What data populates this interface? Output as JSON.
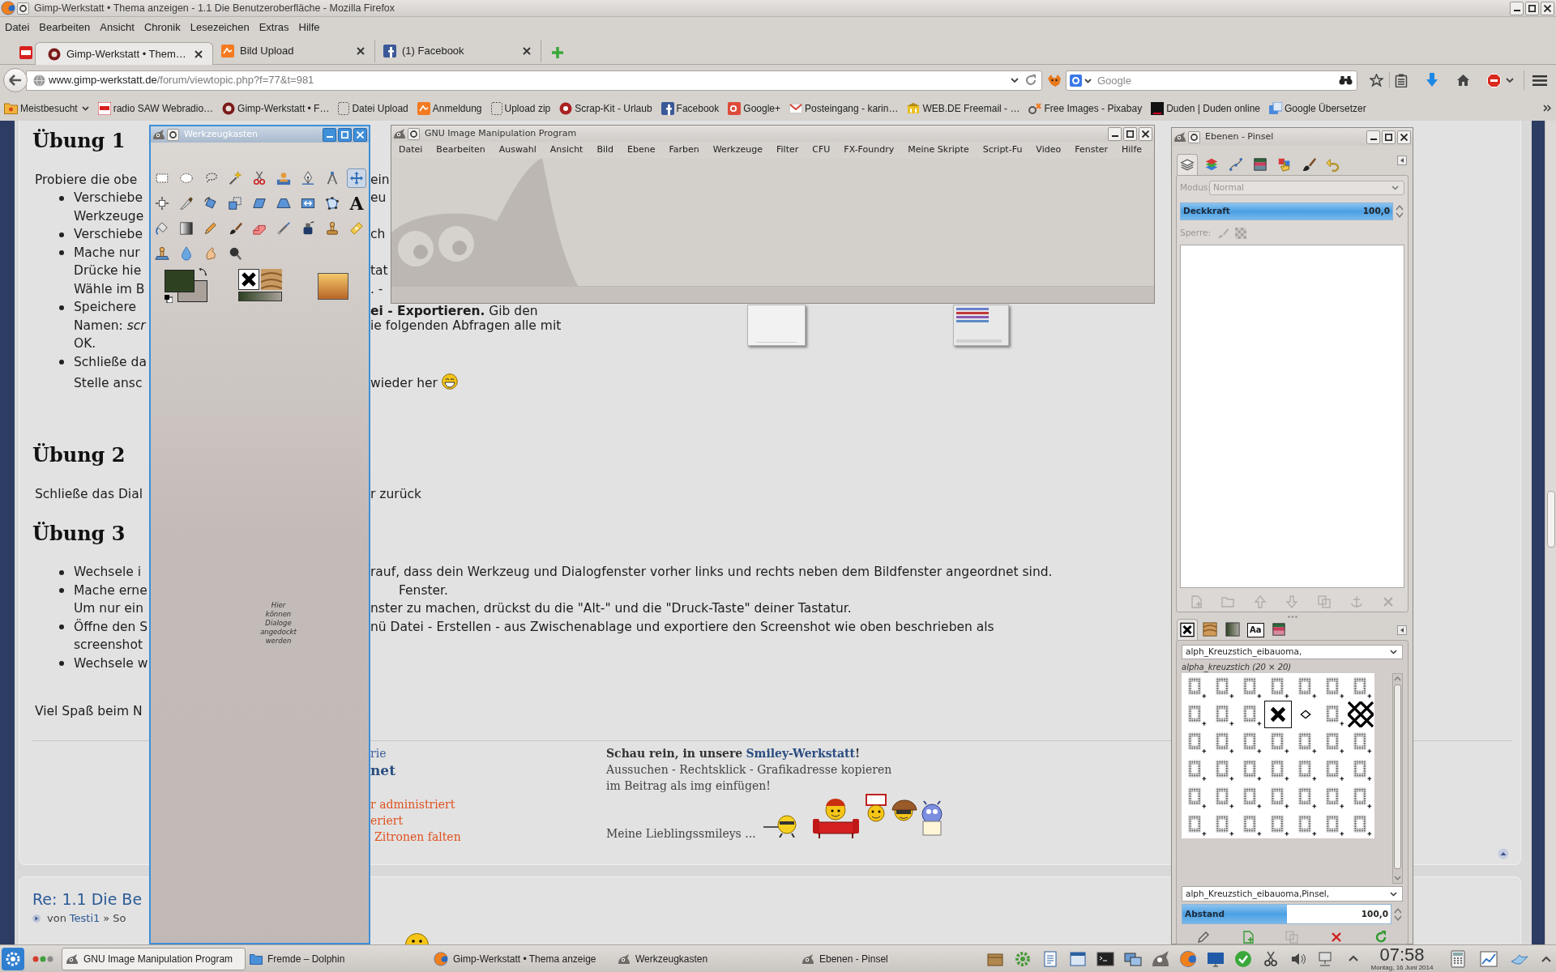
{
  "window": {
    "title": "Gimp-Werkstatt • Thema anzeigen - 1.1 Die Benutzeroberfläche - Mozilla Firefox"
  },
  "menu_bar": [
    "Datei",
    "Bearbeiten",
    "Ansicht",
    "Chronik",
    "Lesezeichen",
    "Extras",
    "Hilfe"
  ],
  "tabs": [
    {
      "kind": "pinned",
      "selected": false
    },
    {
      "kind": "page",
      "label": "Gimp-Werkstatt • Them…",
      "selected": true
    },
    {
      "kind": "page",
      "label": "Bild Upload",
      "selected": false
    },
    {
      "kind": "page",
      "label": "(1) Facebook",
      "selected": false
    }
  ],
  "address_bar": {
    "host": "www.gimp-werkstatt.de",
    "path": "/forum/viewtopic.php?f=77&t=981"
  },
  "search": {
    "placeholder": "Google"
  },
  "bookmarks": [
    {
      "kind": "folder",
      "label": "Meistbesucht"
    },
    {
      "kind": "site",
      "label": "radio SAW Webradio…"
    },
    {
      "kind": "site",
      "label": "Gimp-Werkstatt • F…"
    },
    {
      "kind": "blank",
      "label": "Datei Upload"
    },
    {
      "kind": "site",
      "label": "Anmeldung"
    },
    {
      "kind": "blank",
      "label": "Upload zip"
    },
    {
      "kind": "site",
      "label": "Scrap-Kit - Urlaub"
    },
    {
      "kind": "site",
      "label": "Facebook"
    },
    {
      "kind": "site",
      "label": "Google+"
    },
    {
      "kind": "site",
      "label": "Posteingang - karin…"
    },
    {
      "kind": "site",
      "label": "WEB.DE Freemail - …"
    },
    {
      "kind": "site",
      "label": "Free Images - Pixabay"
    },
    {
      "kind": "site",
      "label": "Duden | Duden online"
    },
    {
      "kind": "site",
      "label": "Google Übersetzer"
    }
  ],
  "post": {
    "lines": [
      {
        "kind": "heading",
        "left": "Übung 1"
      },
      {
        "kind": "text",
        "left": "Probiere die obe",
        "right": "ein"
      },
      {
        "kind": "bullet",
        "left": "Verschiebe",
        "right": "eu"
      },
      {
        "kind": "indent",
        "left": "Werkzeuge"
      },
      {
        "kind": "bullet",
        "left": "Verschiebe",
        "right": "ch"
      },
      {
        "kind": "bullet",
        "left": "Mache nur"
      },
      {
        "kind": "indent",
        "left": "Drücke hie",
        "right": "tat"
      },
      {
        "kind": "indent",
        "left": "Wähle im B",
        "right": ". -"
      },
      {
        "kind": "bullet",
        "left": "Speichere",
        "right": "**ei - Exportieren.** Gib den"
      },
      {
        "kind": "indent",
        "left": "Namen: *scr*",
        "right": "ie folgenden Abfragen alle mit"
      },
      {
        "kind": "indent",
        "left": "OK."
      },
      {
        "kind": "bullet",
        "left": "Schließe da"
      },
      {
        "kind": "note",
        "left": "Stelle ansc",
        "right": "wieder her",
        "smiley": true
      },
      {
        "kind": "heading",
        "left": "Übung 2"
      },
      {
        "kind": "text",
        "left": "Schließe das Dial",
        "right": "r zurück"
      },
      {
        "kind": "heading",
        "left": "Übung 3"
      },
      {
        "kind": "bullet",
        "left": "Wechsele i",
        "right": "rauf, dass dein Werkzeug und Dialogfenster vorher links und rechts neben dem Bildfenster angeordnet sind."
      },
      {
        "kind": "bullet",
        "left": "Mache erne",
        "right": "Fenster."
      },
      {
        "kind": "indent",
        "left": "Um nur ein",
        "right": "nster zu machen, drückst du die \"Alt-\" und die \"Druck-Taste\" deiner Tastatur."
      },
      {
        "kind": "bullet",
        "left": "Öffne den S",
        "right": "nü Datei - Erstellen - aus Zwischenablage und exportiere den Screenshot wie oben beschrieben als"
      },
      {
        "kind": "indent",
        "left": "screenshot"
      },
      {
        "kind": "bullet",
        "left": "Wechsele w"
      },
      {
        "kind": "text",
        "left": "Viel Spaß beim N"
      }
    ],
    "signature": [
      {
        "kind": "link",
        "text": "rie"
      },
      {
        "kind": "title",
        "text": "net"
      },
      {
        "kind": "note",
        "text": "r administriert"
      },
      {
        "kind": "note",
        "text": "eriert"
      },
      {
        "kind": "note",
        "text": "Zitronen falten"
      }
    ],
    "promo": {
      "lead": "Schau rein, in unsere",
      "link": "Smiley-Werkstatt",
      "tail": "!",
      "lines": [
        "Aussuchen - Rechtsklick - Grafikadresse kopieren",
        "im Beitrag als img einfügen!"
      ],
      "favorites": "Meine Lieblingssmileys ..."
    }
  },
  "reply": {
    "title": "Re: 1.1 Die Be",
    "by": "von",
    "author": "Testi1",
    "tail": "» So"
  },
  "toolbox": {
    "title": "Werkzeugkasten",
    "tools": [
      {
        "kind": "rect",
        "selected": false
      },
      {
        "kind": "ellipse",
        "selected": false
      },
      {
        "kind": "lasso",
        "selected": false
      },
      {
        "kind": "wand",
        "selected": false
      },
      {
        "kind": "scissors",
        "selected": false
      },
      {
        "kind": "foreground",
        "selected": false
      },
      {
        "kind": "paths",
        "selected": false
      },
      {
        "kind": "measure",
        "selected": false
      },
      {
        "kind": "move",
        "selected": true
      },
      {
        "kind": "align",
        "selected": false
      },
      {
        "kind": "crop",
        "selected": false
      },
      {
        "kind": "rotate",
        "selected": false
      },
      {
        "kind": "scale",
        "selected": false
      },
      {
        "kind": "shear",
        "selected": false
      },
      {
        "kind": "perspective",
        "selected": false
      },
      {
        "kind": "flip",
        "selected": false
      },
      {
        "kind": "cage",
        "selected": false
      },
      {
        "kind": "text",
        "label": "A",
        "selected": false
      },
      {
        "kind": "bucket",
        "selected": false
      },
      {
        "kind": "blend",
        "selected": false
      },
      {
        "kind": "pencil",
        "selected": false
      },
      {
        "kind": "brush",
        "selected": false
      },
      {
        "kind": "eraser",
        "selected": false
      },
      {
        "kind": "airbrush",
        "selected": false
      },
      {
        "kind": "ink",
        "selected": false
      },
      {
        "kind": "clone",
        "selected": false
      },
      {
        "kind": "heal",
        "selected": false
      },
      {
        "kind": "perspclone",
        "selected": false
      },
      {
        "kind": "blur",
        "selected": false
      },
      {
        "kind": "smudge",
        "selected": false
      },
      {
        "kind": "dodge",
        "selected": false
      }
    ],
    "colors": [
      {
        "kind": "foreground",
        "color": "#2e4222"
      },
      {
        "kind": "background",
        "color": "#a9a19a"
      }
    ],
    "dock_hint": "Hier können Dialoge angedockt werden"
  },
  "gimp": {
    "title": "GNU Image Manipulation Program",
    "menu": [
      "Datei",
      "Bearbeiten",
      "Auswahl",
      "Ansicht",
      "Bild",
      "Ebene",
      "Farben",
      "Werkzeuge",
      "Filter",
      "CFU",
      "FX-Foundry",
      "Meine Skripte",
      "Script-Fu",
      "Video",
      "Fenster",
      "Hilfe"
    ]
  },
  "dock": {
    "title": "Ebenen - Pinsel",
    "layers": {
      "tabs": [
        {
          "kind": "layers",
          "selected": true
        },
        {
          "kind": "channels",
          "selected": false
        },
        {
          "kind": "paths",
          "selected": false
        },
        {
          "kind": "colormap",
          "selected": false
        },
        {
          "kind": "pointer",
          "selected": false
        },
        {
          "kind": "brush",
          "selected": false
        },
        {
          "kind": "undo",
          "selected": false
        }
      ],
      "mode": {
        "label": "Modus:",
        "value": "Normal",
        "disabled": true
      },
      "opacity": {
        "label": "Deckkraft",
        "reading": "100,0",
        "level": 1
      },
      "lock": {
        "label": "Sperre:",
        "disabled": true
      },
      "buttons": [
        {
          "kind": "new",
          "disabled": true
        },
        {
          "kind": "group",
          "disabled": true
        },
        {
          "kind": "raise",
          "disabled": true
        },
        {
          "kind": "lower",
          "disabled": true
        },
        {
          "kind": "duplicate",
          "disabled": true
        },
        {
          "kind": "anchor",
          "disabled": true
        },
        {
          "kind": "delete",
          "disabled": true
        }
      ]
    },
    "brushes": {
      "tabs": [
        {
          "kind": "brushes",
          "selected": true
        },
        {
          "kind": "patterns",
          "selected": false
        },
        {
          "kind": "gradients",
          "selected": false
        },
        {
          "kind": "fonts",
          "label": "Aa",
          "selected": false
        },
        {
          "kind": "palettes",
          "selected": false
        }
      ],
      "filter": "alph_Kreuzstich_eibauoma,",
      "name": "alpha_kreuzstich (20 × 20)",
      "items": [
        {
          "kind": "stitch",
          "selected": false
        },
        {
          "kind": "stitch",
          "selected": false
        },
        {
          "kind": "stitch",
          "selected": false
        },
        {
          "kind": "stitch",
          "selected": false
        },
        {
          "kind": "stitch",
          "selected": false
        },
        {
          "kind": "stitch",
          "selected": false
        },
        {
          "kind": "stitch",
          "selected": false
        },
        {
          "kind": "stitch",
          "selected": false
        },
        {
          "kind": "stitch",
          "selected": false
        },
        {
          "kind": "stitch",
          "selected": false
        },
        {
          "kind": "cross",
          "selected": true
        },
        {
          "kind": "diamond",
          "selected": false
        },
        {
          "kind": "stitch",
          "selected": false
        },
        {
          "kind": "lattice",
          "selected": false
        },
        {
          "kind": "stitch",
          "selected": false
        },
        {
          "kind": "stitch",
          "selected": false
        },
        {
          "kind": "stitch",
          "selected": false
        },
        {
          "kind": "stitch",
          "selected": false
        },
        {
          "kind": "stitch",
          "selected": false
        },
        {
          "kind": "stitch",
          "selected": false
        },
        {
          "kind": "stitch",
          "selected": false
        },
        {
          "kind": "stitch",
          "selected": false
        },
        {
          "kind": "stitch",
          "selected": false
        },
        {
          "kind": "stitch",
          "selected": false
        },
        {
          "kind": "stitch",
          "selected": false
        },
        {
          "kind": "stitch",
          "selected": false
        },
        {
          "kind": "stitch",
          "selected": false
        },
        {
          "kind": "stitch",
          "selected": false
        },
        {
          "kind": "stitch",
          "selected": false
        },
        {
          "kind": "stitch",
          "selected": false
        },
        {
          "kind": "stitch",
          "selected": false
        },
        {
          "kind": "stitch",
          "selected": false
        },
        {
          "kind": "stitch",
          "selected": false
        },
        {
          "kind": "stitch",
          "selected": false
        },
        {
          "kind": "stitch",
          "selected": false
        },
        {
          "kind": "stitch",
          "selected": false
        },
        {
          "kind": "stitch",
          "selected": false
        },
        {
          "kind": "stitch",
          "selected": false
        },
        {
          "kind": "stitch",
          "selected": false
        },
        {
          "kind": "stitch",
          "selected": false
        },
        {
          "kind": "stitch",
          "selected": false
        },
        {
          "kind": "stitch",
          "selected": false
        }
      ],
      "tags": "alph_Kreuzstich_eibauoma,Pinsel,",
      "spacing": {
        "label": "Abstand",
        "reading": "100,0",
        "level": 0.5
      },
      "buttons": [
        {
          "kind": "edit",
          "disabled": false
        },
        {
          "kind": "new",
          "disabled": false
        },
        {
          "kind": "duplicate",
          "disabled": true
        },
        {
          "kind": "delete",
          "disabled": false
        },
        {
          "kind": "refresh",
          "disabled": false
        }
      ]
    }
  },
  "taskbar": {
    "tasks": [
      {
        "kind": "gimp",
        "label": "GNU Image Manipulation Program",
        "selected": true
      },
      {
        "kind": "files",
        "label": "Fremde – Dolphin",
        "selected": false
      },
      {
        "kind": "browser",
        "label": "Gimp-Werkstatt • Thema anzeige",
        "selected": false
      },
      {
        "kind": "gimp",
        "label": "Werkzeugkasten",
        "selected": false
      },
      {
        "kind": "gimp",
        "label": "Ebenen - Pinsel",
        "selected": false
      }
    ],
    "time": "07:58",
    "date": "Montag, 16 Juni 2014"
  }
}
